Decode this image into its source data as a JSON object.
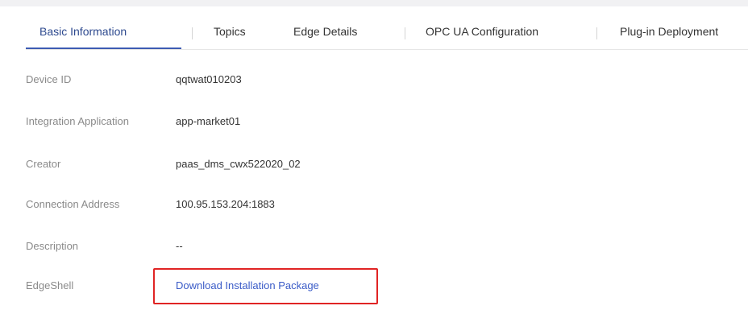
{
  "tabs": [
    {
      "label": "Basic Information",
      "active": true
    },
    {
      "label": "Topics",
      "active": false
    },
    {
      "label": "Edge Details",
      "active": false
    },
    {
      "label": "OPC UA Configuration",
      "active": false
    },
    {
      "label": "Plug-in Deployment",
      "active": false
    }
  ],
  "info": {
    "device_id": {
      "label": "Device ID",
      "value": "qqtwat010203"
    },
    "integration_application": {
      "label": "Integration Application",
      "value": "app-market01"
    },
    "creator": {
      "label": "Creator",
      "value": "paas_dms_cwx522020_02"
    },
    "connection_address": {
      "label": "Connection Address",
      "value": "100.95.153.204:1883"
    },
    "description": {
      "label": "Description",
      "value": "--"
    },
    "edgeshell": {
      "label": "EdgeShell",
      "link_text": "Download Installation Package"
    }
  },
  "colors": {
    "accent": "#3d5bb3",
    "link": "#3a5bc7",
    "highlight_box": "#e02424"
  }
}
